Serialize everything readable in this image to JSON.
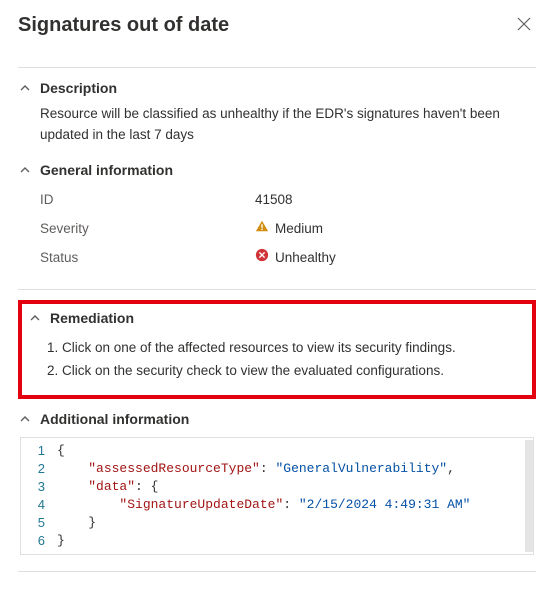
{
  "header": {
    "title": "Signatures out of date"
  },
  "sections": {
    "description": {
      "title": "Description",
      "text": "Resource will be classified as unhealthy if the EDR's signatures haven't been updated in the last 7 days"
    },
    "general": {
      "title": "General information",
      "rows": {
        "id": {
          "label": "ID",
          "value": "41508"
        },
        "severity": {
          "label": "Severity",
          "value": "Medium"
        },
        "status": {
          "label": "Status",
          "value": "Unhealthy"
        }
      }
    },
    "remediation": {
      "title": "Remediation",
      "steps": {
        "s1": "Click on one of the affected resources to view its security findings.",
        "s2": "Click on the security check to view the evaluated configurations."
      }
    },
    "additional": {
      "title": "Additional information",
      "gutter": {
        "l1": "1",
        "l2": "2",
        "l3": "3",
        "l4": "4",
        "l5": "5",
        "l6": "6"
      },
      "json": {
        "k1": "\"assessedResourceType\"",
        "v1": "\"GeneralVulnerability\"",
        "k2": "\"data\"",
        "k3": "\"SignatureUpdateDate\"",
        "v3": "\"2/15/2024 4:49:31 AM\""
      }
    }
  },
  "colors": {
    "highlight_border": "#e3000f",
    "severity_icon": "#d18d0f",
    "status_icon": "#d13438"
  }
}
